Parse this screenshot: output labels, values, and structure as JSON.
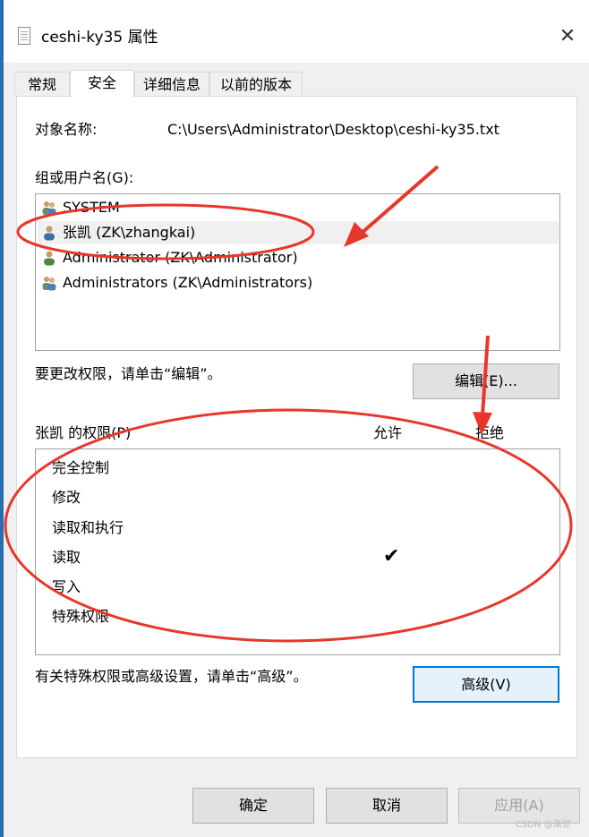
{
  "window": {
    "title": "ceshi-ky35 属性",
    "close_glyph": "✕"
  },
  "tabs": [
    {
      "label": "常规"
    },
    {
      "label": "安全"
    },
    {
      "label": "详细信息"
    },
    {
      "label": "以前的版本"
    }
  ],
  "security": {
    "object_label": "对象名称:",
    "object_value": "C:\\Users\\Administrator\\Desktop\\ceshi-ky35.txt",
    "groups_label": "组或用户名(G):",
    "users": [
      {
        "name": "SYSTEM",
        "icon": "group-users-icon"
      },
      {
        "name": "张凯 (ZK\\zhangkai)",
        "icon": "user-icon",
        "selected": true
      },
      {
        "name": "Administrator (ZK\\Administrator)",
        "icon": "user-icon"
      },
      {
        "name": "Administrators (ZK\\Administrators)",
        "icon": "group-users-icon"
      }
    ],
    "edit_hint": "要更改权限，请单击“编辑”。",
    "edit_button": "编辑(E)...",
    "perm_title": "张凯 的权限(P)",
    "allow_header": "允许",
    "deny_header": "拒绝",
    "permissions": [
      {
        "name": "完全控制",
        "allow": false,
        "deny": false
      },
      {
        "name": "修改",
        "allow": false,
        "deny": false
      },
      {
        "name": "读取和执行",
        "allow": false,
        "deny": false
      },
      {
        "name": "读取",
        "allow": true,
        "deny": false
      },
      {
        "name": "写入",
        "allow": false,
        "deny": false
      },
      {
        "name": "特殊权限",
        "allow": false,
        "deny": false
      }
    ],
    "check_glyph": "✔",
    "advanced_hint": "有关特殊权限或高级设置，请单击“高级”。",
    "advanced_button": "高级(V)"
  },
  "footer": {
    "ok": "确定",
    "cancel": "取消",
    "apply": "应用(A)"
  },
  "watermark": "CSDN @渐觉",
  "annotation_color": "#e8372a"
}
